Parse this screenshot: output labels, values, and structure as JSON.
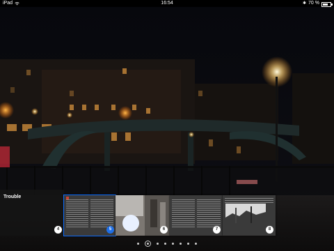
{
  "status": {
    "device": "iPad",
    "time": "16:54",
    "battery": "70 %",
    "battery_level": 0.7
  },
  "story": {
    "category": "",
    "title": "Trouble"
  },
  "thumbnails": [
    {
      "badge": "4",
      "kind": "photo-dark"
    },
    {
      "badge": "5",
      "kind": "text",
      "active": true
    },
    {
      "badge": "6",
      "kind": "photo-bright"
    },
    {
      "badge": "7",
      "kind": "text"
    },
    {
      "badge": "8",
      "kind": "text-photo"
    }
  ],
  "pager": {
    "count": 8,
    "current": 1
  }
}
